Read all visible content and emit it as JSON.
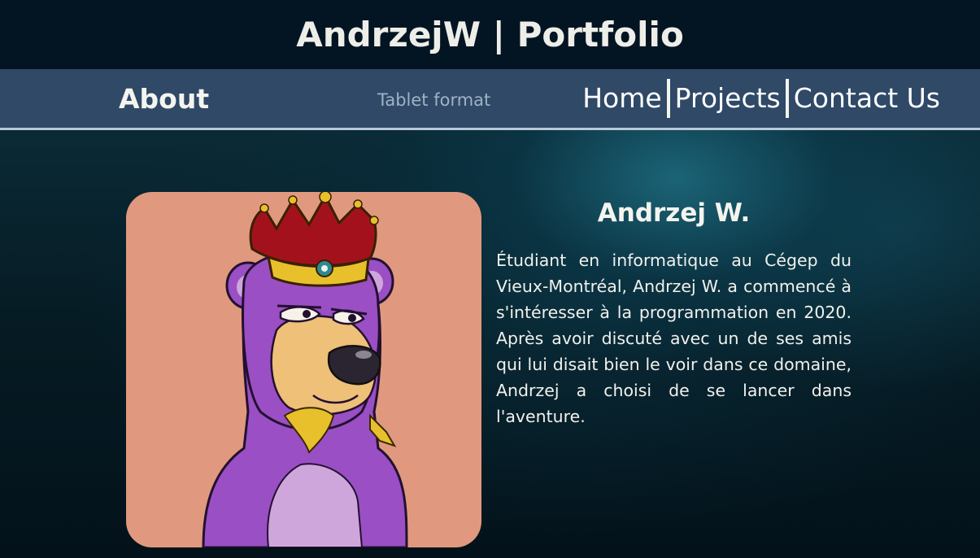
{
  "header": {
    "title": "AndrzejW | Portfolio"
  },
  "nav": {
    "section_heading": "About",
    "format_label": "Tablet format",
    "links": [
      {
        "label": "Home"
      },
      {
        "label": "Projects"
      },
      {
        "label": "Contact Us"
      }
    ]
  },
  "profile": {
    "name": "Andrzej W.",
    "bio": "Étudiant en informatique au Cégep du Vieux-Montréal, Andrzej W. a commencé à s'intéresser à la programmation en 2020. Après avoir discuté avec un de ses amis qui lui disait bien le voir dans ce domaine, Andrzej a choisi de se lancer dans l'aventure.",
    "avatar_icon": "crowned-purple-bear-illustration"
  },
  "colors": {
    "header_bg": "#031423",
    "navbar_bg": "#2f4967",
    "avatar_bg": "#e0997e",
    "text": "#f4f4ef"
  }
}
